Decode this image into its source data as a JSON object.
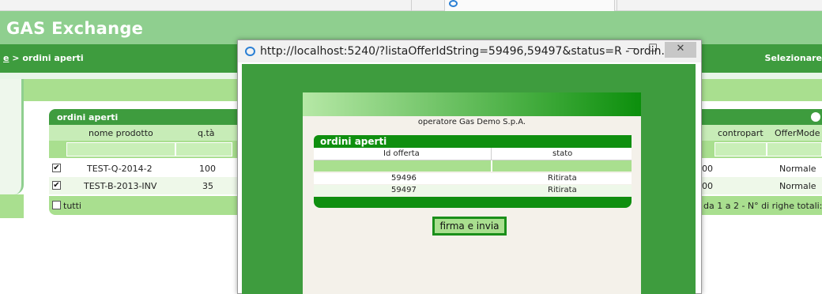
{
  "app": {
    "title": "GAS Exchange",
    "breadcrumb_link": "e",
    "breadcrumb_rest": " > ordini aperti",
    "select_label": "Selezionare"
  },
  "main_table": {
    "title": "ordini aperti",
    "columns_left": [
      "nome prodotto",
      "q.tà"
    ],
    "columns_right": [
      "contropart",
      "OfferMode"
    ],
    "rows": [
      {
        "checked": true,
        "product": "TEST-Q-2014-2",
        "qty": "100",
        "hidden_val": "00",
        "offer_mode": "Normale"
      },
      {
        "checked": true,
        "product": "TEST-B-2013-INV",
        "qty": "35",
        "hidden_val": "00",
        "offer_mode": "Normale"
      }
    ],
    "select_all_label": "tutti",
    "pagination": "da 1 a 2 - N° di righe totali:"
  },
  "popup": {
    "url_title": "http://localhost:5240/?listaOfferIdString=59496,59497&status=R - ordin...",
    "operator": "operatore Gas Demo S.p.A.",
    "table_title": "ordini aperti",
    "columns": [
      "Id offerta",
      "stato"
    ],
    "rows": [
      {
        "id": "59496",
        "status": "Ritirata"
      },
      {
        "id": "59497",
        "status": "Ritirata"
      }
    ],
    "sign_button": "firma e invia",
    "min_glyph": "—",
    "max_glyph": "☐",
    "close_glyph": "✕"
  },
  "colors": {
    "header_light": "#8fcf8f",
    "header_dark": "#3e9c3e",
    "row_green": "#a9df8f",
    "popup_green": "#0f8f0f"
  }
}
